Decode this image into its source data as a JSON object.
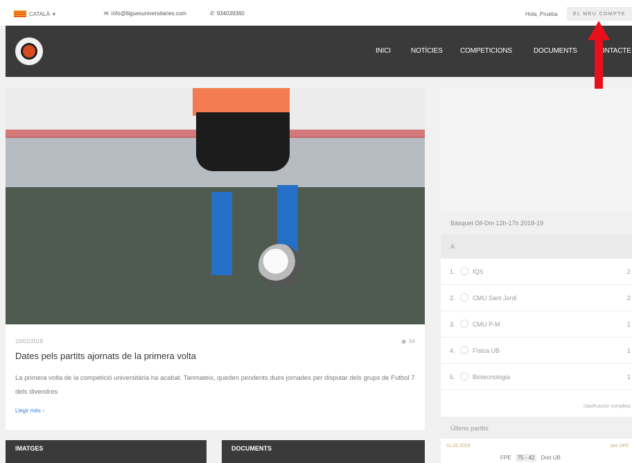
{
  "topbar": {
    "language": "CATALÀ",
    "email": "info@lliguesuniversitaries.com",
    "phone": "934039360",
    "greeting": "Hola, Prueba",
    "account_button": "EL MEU COMPTE"
  },
  "nav": {
    "items": [
      "INICI",
      "NOTÍCIES",
      "COMPETICIONS",
      "DOCUMENTS",
      "CONTACTE"
    ]
  },
  "article": {
    "date": "15/01/2019",
    "views": "54",
    "title": "Dates pels partits ajornats de la primera volta",
    "excerpt": "La primera volta de la competició universitària ha acabat. Tanmateix, queden pendents dues jornades per disputar dels grups de Futbol 7 dels divendres",
    "read_more": "Llegir més"
  },
  "sections": {
    "images": "IMATGES",
    "documents": "DOCUMENTS"
  },
  "standings": {
    "title": "Bàsquet Dll-Dm 12h-17h 2018-19",
    "group": "A",
    "rows": [
      {
        "pos": "1.",
        "team": "IQS",
        "pts": "2"
      },
      {
        "pos": "2.",
        "team": "CMU Sant Jordi",
        "pts": "2"
      },
      {
        "pos": "3.",
        "team": "CMU P-M",
        "pts": "1"
      },
      {
        "pos": "4.",
        "team": "Física UB",
        "pts": "1"
      },
      {
        "pos": "5.",
        "team": "Biotecnologia",
        "pts": "1"
      }
    ],
    "full_link": "clasificación completa"
  },
  "results": {
    "title": "Últims partits",
    "date": "11.02.2019",
    "by": "por UPC",
    "home": "FPE",
    "score": "75 - 42",
    "away": "Dret UB"
  },
  "colors": {
    "nav_bg": "#3a3a3a",
    "link": "#3b7dd8",
    "arrow": "#e8101a"
  }
}
